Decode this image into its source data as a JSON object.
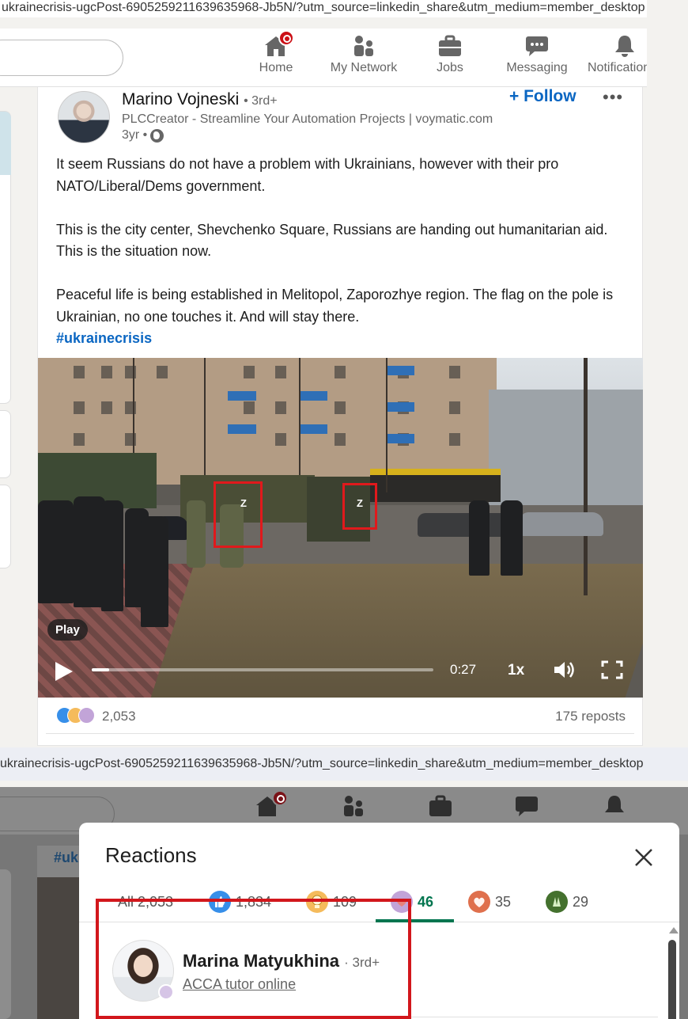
{
  "top": {
    "url": "ukrainecrisis-ugcPost-6905259211639635968-Jb5N/?utm_source=linkedin_share&utm_medium=member_desktop",
    "nav": [
      {
        "label": "Home",
        "icon": "home-icon"
      },
      {
        "label": "My Network",
        "icon": "network-icon"
      },
      {
        "label": "Jobs",
        "icon": "briefcase-icon"
      },
      {
        "label": "Messaging",
        "icon": "chat-icon"
      },
      {
        "label": "Notifications",
        "icon": "bell-icon"
      }
    ],
    "post": {
      "author": "Marino Vojneski",
      "degree": "• 3rd+",
      "headline": "PLCCreator - Streamline Your Automation Projects | voymatic.com",
      "time": "3yr •",
      "follow": "+ Follow",
      "more": "•••",
      "paragraphs": [
        "It seem Russians do not have a problem with Ukrainians, however with their pro NATO/Liberal/Dems government.",
        "This is the city center, Shevchenko Square, Russians are handing out humanitarian aid. This is the situation now.",
        "Peaceful life is being established in Melitopol, Zaporozhye region. The flag on the pole is Ukrainian, no one touches it. And will stay there."
      ],
      "hashtag": "#ukrainecrisis",
      "video": {
        "play_label": "Play",
        "time": "0:27",
        "speed": "1x",
        "progress": 0.05,
        "vehicle_marking": "Z"
      },
      "reaction_count": "2,053",
      "reposts": "175 reposts"
    }
  },
  "bottom": {
    "url": "ukrainecrisis-ugcPost-6905259211639635968-Jb5N/?utm_source=linkedin_share&utm_medium=member_desktop",
    "under_hashtag": "#uk",
    "modal": {
      "title": "Reactions",
      "tabs": [
        {
          "label": "All 2,053",
          "icon": "",
          "color": ""
        },
        {
          "label": "1,834",
          "icon": "like-icon",
          "color": "#378fe9"
        },
        {
          "label": "109",
          "icon": "insightful-icon",
          "color": "#f5bb5c"
        },
        {
          "label": "46",
          "icon": "support-icon",
          "color": "#c2a4d8"
        },
        {
          "label": "35",
          "icon": "love-icon",
          "color": "#df704d"
        },
        {
          "label": "29",
          "icon": "celebrate-icon",
          "color": "#44712e"
        }
      ],
      "active_tab": 3,
      "reactor": {
        "name": "Marina Matyukhina",
        "degree": "· 3rd+",
        "headline": "ACCA tutor online"
      }
    }
  },
  "colors": {
    "linkedin_blue": "#0a66c2",
    "active_green": "#01754f",
    "highlight_red": "#d2171c"
  }
}
